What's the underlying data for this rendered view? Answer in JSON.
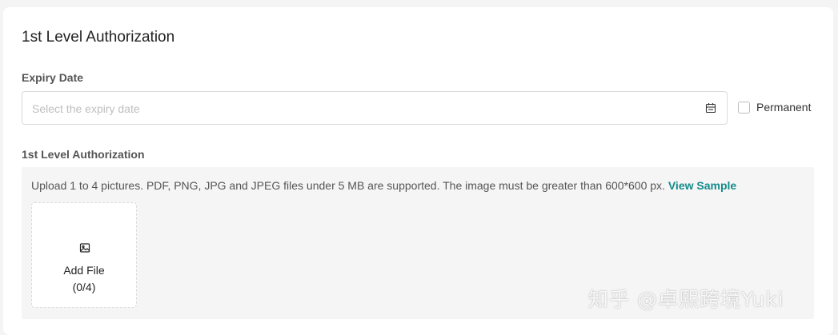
{
  "section": {
    "title": "1st Level Authorization"
  },
  "expiry": {
    "label": "Expiry Date",
    "placeholder": "Select the expiry date",
    "icon": "calendar-icon",
    "permanent_label": "Permanent",
    "permanent_checked": false
  },
  "authorization": {
    "label": "1st Level Authorization",
    "hint": "Upload 1 to 4 pictures. PDF, PNG, JPG and JPEG files under 5 MB are supported. The image must be greater than 600*600 px.",
    "view_sample": "View Sample",
    "add_file": {
      "icon": "image-icon",
      "label": "Add File",
      "count": "(0/4)"
    }
  },
  "watermark": "知乎 @卓熙跨境Yuki",
  "colors": {
    "accent": "#138a8a",
    "background": "#f4f4f5",
    "upload_bg": "#f5f5f5"
  }
}
